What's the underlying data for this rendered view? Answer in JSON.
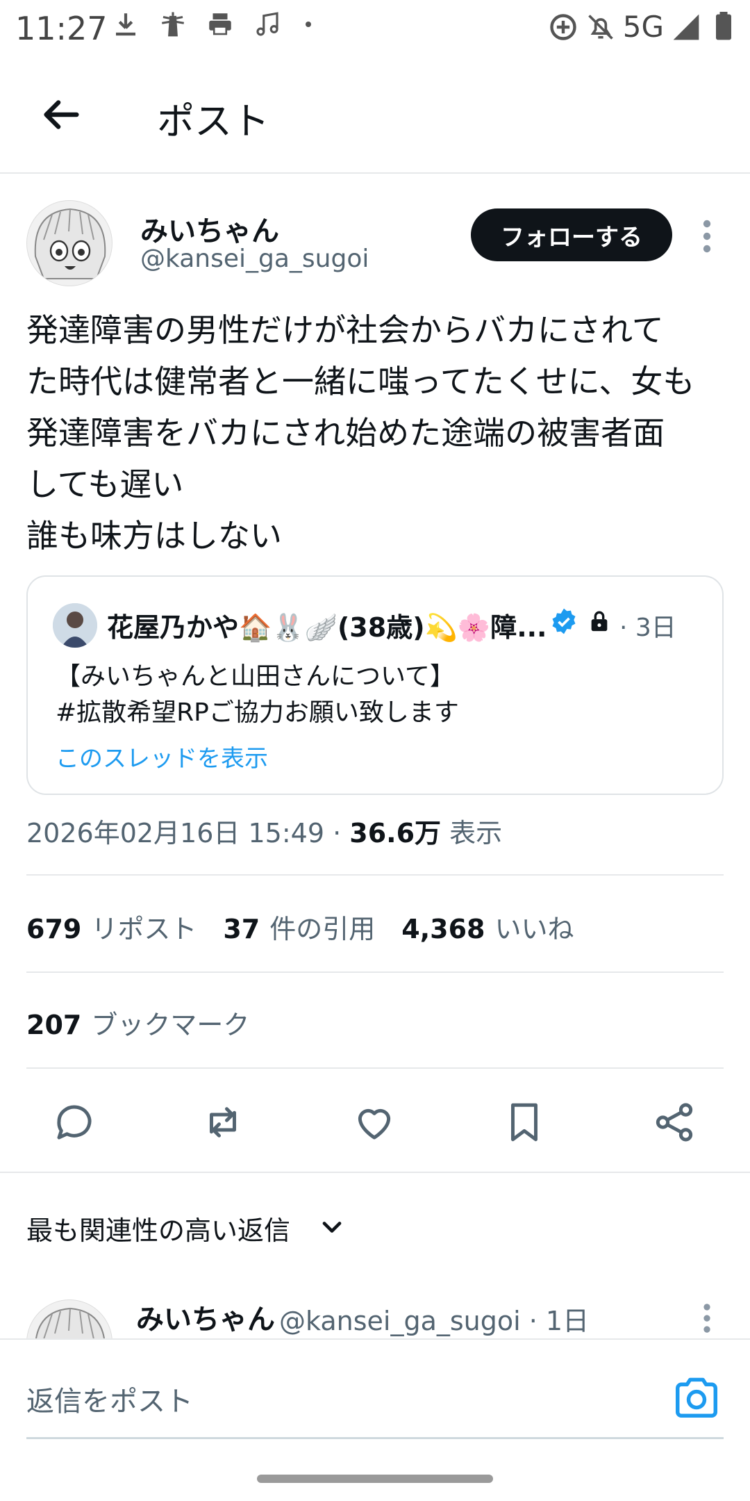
{
  "status_bar": {
    "time": "11:27",
    "network": "5G",
    "left_icons": [
      "download-icon",
      "lighthouse-icon",
      "printer-icon",
      "music-icon",
      "dot-icon"
    ],
    "right_icons": [
      "data-saver-icon",
      "bell-off-icon",
      "signal-icon",
      "battery-icon"
    ]
  },
  "header": {
    "title": "ポスト",
    "back_icon": "arrow-left-icon"
  },
  "post": {
    "author_name": "みいちゃん",
    "author_handle": "@kansei_ga_sugoi",
    "follow_label": "フォローする",
    "body": "発達障害の男性だけが社会からバカにされて\nた時代は健常者と一緒に嗤ってたくせに、女も\n発達障害をバカにされ始めた途端の被害者面\nしても遅い\n誰も味方はしない",
    "quote": {
      "author_name": "花屋乃かや🏠🐰🪽(38歳)💫🌸障...",
      "date": "· 3日",
      "text": "【みいちゃんと山田さんについて】\n#拡散希望RPご協力お願い致します",
      "thread_link": "このスレッドを表示"
    },
    "timestamp": "2026年02月16日 15:49",
    "separator": "·",
    "views_count": "36.6万",
    "views_label": "表示"
  },
  "stats": {
    "reposts": "679",
    "reposts_label": "リポスト",
    "quotes": "37",
    "quotes_label": "件の引用",
    "likes": "4,368",
    "likes_label": "いいね",
    "bookmarks": "207",
    "bookmarks_label": "ブックマーク"
  },
  "actions": [
    "reply-icon",
    "repost-icon",
    "like-icon",
    "bookmark-icon",
    "share-icon"
  ],
  "replies": {
    "sort_label": "最も関連性の高い返信",
    "first_reply": {
      "author_name": "みいちゃん",
      "meta": "@kansei_ga_sugoi · 1日"
    }
  },
  "compose": {
    "placeholder": "返信をポスト"
  },
  "colors": {
    "accent": "#1d9bf0",
    "text_primary": "#0f1419",
    "text_secondary": "#536471",
    "follow_bg": "#0f1419"
  }
}
